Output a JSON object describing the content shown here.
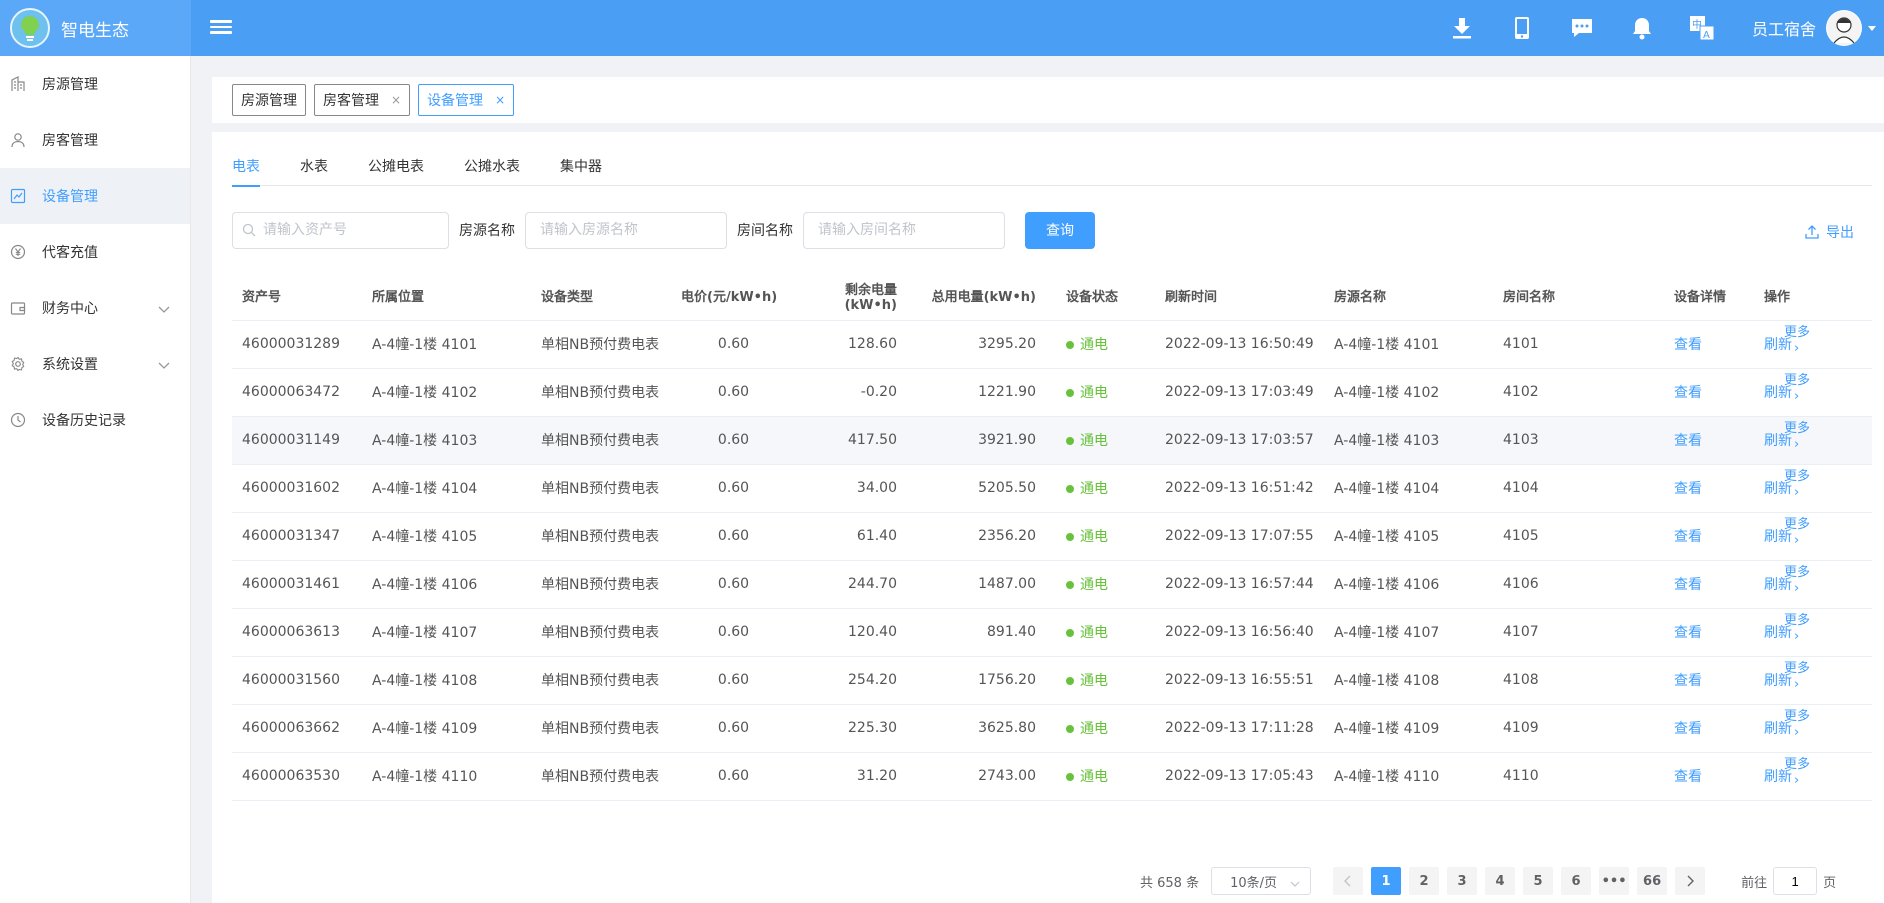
{
  "header": {
    "brand_title": "智电生态",
    "user_name": "员工宿舍",
    "icons": [
      "download-icon",
      "mobile-icon",
      "message-icon",
      "bell-icon",
      "translate-icon"
    ],
    "colors": {
      "bar": "#4a9ff5",
      "brand": "#5aa8f7"
    }
  },
  "sidebar": {
    "items": [
      {
        "label": "房源管理",
        "icon": "building-icon"
      },
      {
        "label": "房客管理",
        "icon": "user-icon"
      },
      {
        "label": "设备管理",
        "icon": "device-icon",
        "active": true
      },
      {
        "label": "代客充值",
        "icon": "yen-icon"
      },
      {
        "label": "财务中心",
        "icon": "wallet-icon",
        "expandable": true
      },
      {
        "label": "系统设置",
        "icon": "gear-icon",
        "expandable": true
      },
      {
        "label": "设备历史记录",
        "icon": "history-icon"
      }
    ]
  },
  "tagbar": {
    "tags": [
      {
        "label": "房源管理",
        "closable": false
      },
      {
        "label": "房客管理",
        "closable": true
      },
      {
        "label": "设备管理",
        "closable": true,
        "active": true
      }
    ],
    "close_glyph": "×"
  },
  "tabs": [
    "电表",
    "水表",
    "公摊电表",
    "公摊水表",
    "集中器"
  ],
  "filters": {
    "asset_placeholder": "请输入资产号",
    "property_label": "房源名称",
    "property_placeholder": "请输入房源名称",
    "room_label": "房间名称",
    "room_placeholder": "请输入房间名称",
    "query_button": "查询",
    "export_label": "导出"
  },
  "table": {
    "columns": [
      "资产号",
      "所属位置",
      "设备类型",
      "电价(元/kW•h)",
      "剩余电量(kW•h)",
      "总用电量(kW•h)",
      "设备状态",
      "刷新时间",
      "房源名称",
      "房间名称",
      "设备详情",
      "操作"
    ],
    "view_label": "查看",
    "refresh_label": "刷新",
    "more_label": "更多",
    "rows": [
      {
        "asset": "46000031289",
        "location": "A-4幢-1楼 4101",
        "type": "单相NB预付费电表",
        "price": "0.60",
        "remaining": "128.60",
        "total": "3295.20",
        "status": "通电",
        "refresh_time": "2022-09-13 16:50:49",
        "property": "A-4幢-1楼 4101",
        "room": "4101"
      },
      {
        "asset": "46000063472",
        "location": "A-4幢-1楼 4102",
        "type": "单相NB预付费电表",
        "price": "0.60",
        "remaining": "-0.20",
        "total": "1221.90",
        "status": "通电",
        "refresh_time": "2022-09-13 17:03:49",
        "property": "A-4幢-1楼 4102",
        "room": "4102"
      },
      {
        "asset": "46000031149",
        "location": "A-4幢-1楼 4103",
        "type": "单相NB预付费电表",
        "price": "0.60",
        "remaining": "417.50",
        "total": "3921.90",
        "status": "通电",
        "refresh_time": "2022-09-13 17:03:57",
        "property": "A-4幢-1楼 4103",
        "room": "4103"
      },
      {
        "asset": "46000031602",
        "location": "A-4幢-1楼 4104",
        "type": "单相NB预付费电表",
        "price": "0.60",
        "remaining": "34.00",
        "total": "5205.50",
        "status": "通电",
        "refresh_time": "2022-09-13 16:51:42",
        "property": "A-4幢-1楼 4104",
        "room": "4104"
      },
      {
        "asset": "46000031347",
        "location": "A-4幢-1楼 4105",
        "type": "单相NB预付费电表",
        "price": "0.60",
        "remaining": "61.40",
        "total": "2356.20",
        "status": "通电",
        "refresh_time": "2022-09-13 17:07:55",
        "property": "A-4幢-1楼 4105",
        "room": "4105"
      },
      {
        "asset": "46000031461",
        "location": "A-4幢-1楼 4106",
        "type": "单相NB预付费电表",
        "price": "0.60",
        "remaining": "244.70",
        "total": "1487.00",
        "status": "通电",
        "refresh_time": "2022-09-13 16:57:44",
        "property": "A-4幢-1楼 4106",
        "room": "4106"
      },
      {
        "asset": "46000063613",
        "location": "A-4幢-1楼 4107",
        "type": "单相NB预付费电表",
        "price": "0.60",
        "remaining": "120.40",
        "total": "891.40",
        "status": "通电",
        "refresh_time": "2022-09-13 16:56:40",
        "property": "A-4幢-1楼 4107",
        "room": "4107"
      },
      {
        "asset": "46000031560",
        "location": "A-4幢-1楼 4108",
        "type": "单相NB预付费电表",
        "price": "0.60",
        "remaining": "254.20",
        "total": "1756.20",
        "status": "通电",
        "refresh_time": "2022-09-13 16:55:51",
        "property": "A-4幢-1楼 4108",
        "room": "4108"
      },
      {
        "asset": "46000063662",
        "location": "A-4幢-1楼 4109",
        "type": "单相NB预付费电表",
        "price": "0.60",
        "remaining": "225.30",
        "total": "3625.80",
        "status": "通电",
        "refresh_time": "2022-09-13 17:11:28",
        "property": "A-4幢-1楼 4109",
        "room": "4109"
      },
      {
        "asset": "46000063530",
        "location": "A-4幢-1楼 4110",
        "type": "单相NB预付费电表",
        "price": "0.60",
        "remaining": "31.20",
        "total": "2743.00",
        "status": "通电",
        "refresh_time": "2022-09-13 17:05:43",
        "property": "A-4幢-1楼 4110",
        "room": "4110"
      }
    ]
  },
  "pagination": {
    "total_text": "共 658 条",
    "page_size": "10条/页",
    "pages": [
      "1",
      "2",
      "3",
      "4",
      "5",
      "6",
      "•••",
      "66"
    ],
    "current_page": "1",
    "goto_label": "前往",
    "goto_value": "1",
    "page_suffix": "页"
  }
}
